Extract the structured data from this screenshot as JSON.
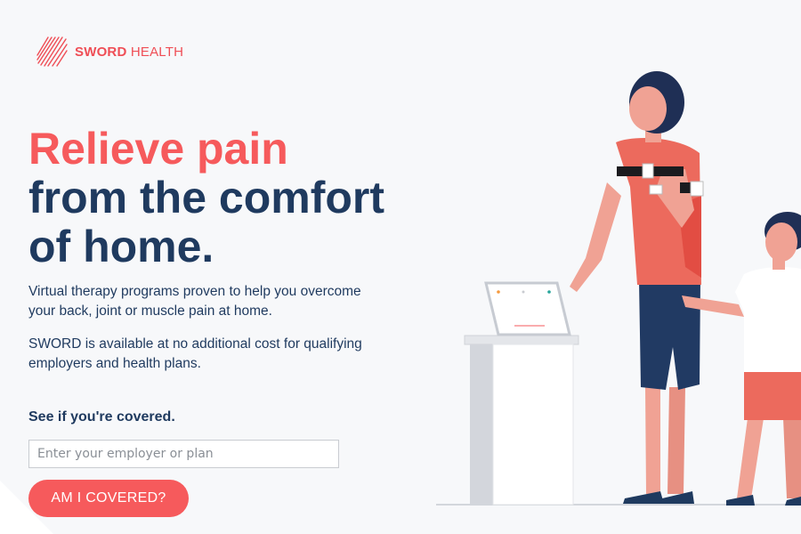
{
  "brand": {
    "name_bold": "SWORD",
    "name_light": " HEALTH",
    "icon": "sword-logo-icon",
    "color": "#ef4e56"
  },
  "hero": {
    "headline_accent": "Relieve pain",
    "headline_line2": "from the comfort",
    "headline_line3": "of home.",
    "accent_color": "#f65a5c",
    "text_color": "#1f3a5f"
  },
  "description": {
    "paragraph1": "Virtual therapy programs proven to help you overcome your back, joint or muscle pain at home.",
    "paragraph2": "SWORD is available at no additional cost for qualifying employers and health plans."
  },
  "coverage": {
    "label": "See if you're covered.",
    "input_placeholder": "Enter your employer or plan",
    "input_value": "",
    "button_label": "AM I COVERED?",
    "button_color": "#f65a5c"
  },
  "illustration": {
    "icon": "therapy-illustration",
    "description_icons": [
      "woman-figure",
      "child-figure",
      "tablet-on-stand"
    ]
  }
}
